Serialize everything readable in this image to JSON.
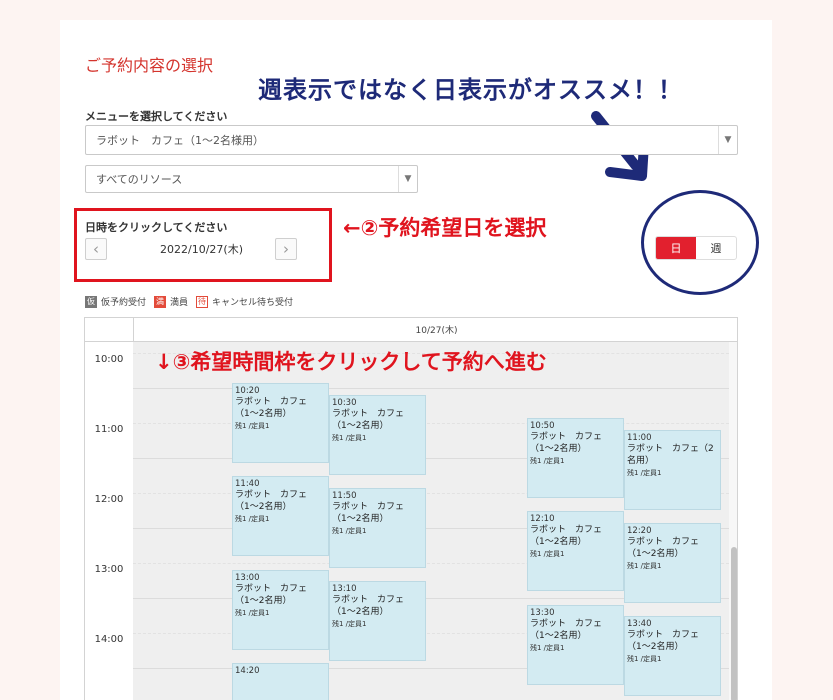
{
  "page": {
    "title": "ご予約内容の選択",
    "headline": "週表示ではなく日表示がオススメ！！"
  },
  "menu": {
    "label": "メニューを選択してください",
    "selected": "ラボット　カフェ（1〜2名様用）"
  },
  "resource": {
    "selected": "すべてのリソース"
  },
  "date_picker": {
    "label": "日時をクリックしてください",
    "date": "2022/10/27(木)",
    "prev_icon": "chevron-left-icon",
    "next_icon": "chevron-right-icon"
  },
  "step2": "←②予約希望日を選択",
  "view_toggle": {
    "day": "日",
    "week": "週",
    "active": "day",
    "accent": "#e2202e"
  },
  "legend": {
    "items": [
      {
        "badge": "仮",
        "label": "仮予約受付"
      },
      {
        "badge": "満",
        "label": "満員"
      },
      {
        "badge": "待",
        "label": "キャンセル待ち受付"
      }
    ]
  },
  "calendar": {
    "header_date": "10/27(木)",
    "times": [
      "10:00",
      "11:00",
      "12:00",
      "13:00",
      "14:00"
    ],
    "events": [
      {
        "time": "10:20",
        "name": "ラボット　カフェ（1〜2名用）",
        "rem": "残1 /定員1",
        "col": 0
      },
      {
        "time": "10:30",
        "name": "ラボット　カフェ（1〜2名用）",
        "rem": "残1 /定員1",
        "col": 1
      },
      {
        "time": "10:50",
        "name": "ラボット　カフェ（1〜2名用）",
        "rem": "残1 /定員1",
        "col": 3
      },
      {
        "time": "11:00",
        "name": "ラボット　カフェ（2名用）",
        "rem": "残1 /定員1",
        "col": 4
      },
      {
        "time": "11:40",
        "name": "ラボット　カフェ（1〜2名用）",
        "rem": "残1 /定員1",
        "col": 0
      },
      {
        "time": "11:50",
        "name": "ラボット　カフェ（1〜2名用）",
        "rem": "残1 /定員1",
        "col": 1
      },
      {
        "time": "12:10",
        "name": "ラボット　カフェ（1〜2名用）",
        "rem": "残1 /定員1",
        "col": 3
      },
      {
        "time": "12:20",
        "name": "ラボット　カフェ（1〜2名用）",
        "rem": "残1 /定員1",
        "col": 4
      },
      {
        "time": "13:00",
        "name": "ラボット　カフェ（1〜2名用）",
        "rem": "残1 /定員1",
        "col": 0
      },
      {
        "time": "13:10",
        "name": "ラボット　カフェ（1〜2名用）",
        "rem": "残1 /定員1",
        "col": 1
      },
      {
        "time": "13:30",
        "name": "ラボット　カフェ（1〜2名用）",
        "rem": "残1 /定員1",
        "col": 3
      },
      {
        "time": "13:40",
        "name": "ラボット　カフェ（1〜2名用）",
        "rem": "残1 /定員1",
        "col": 4
      },
      {
        "time": "14:20",
        "name": "",
        "rem": "",
        "col": 0
      }
    ]
  },
  "step3": "↓③希望時間枠をクリックして予約へ進む"
}
